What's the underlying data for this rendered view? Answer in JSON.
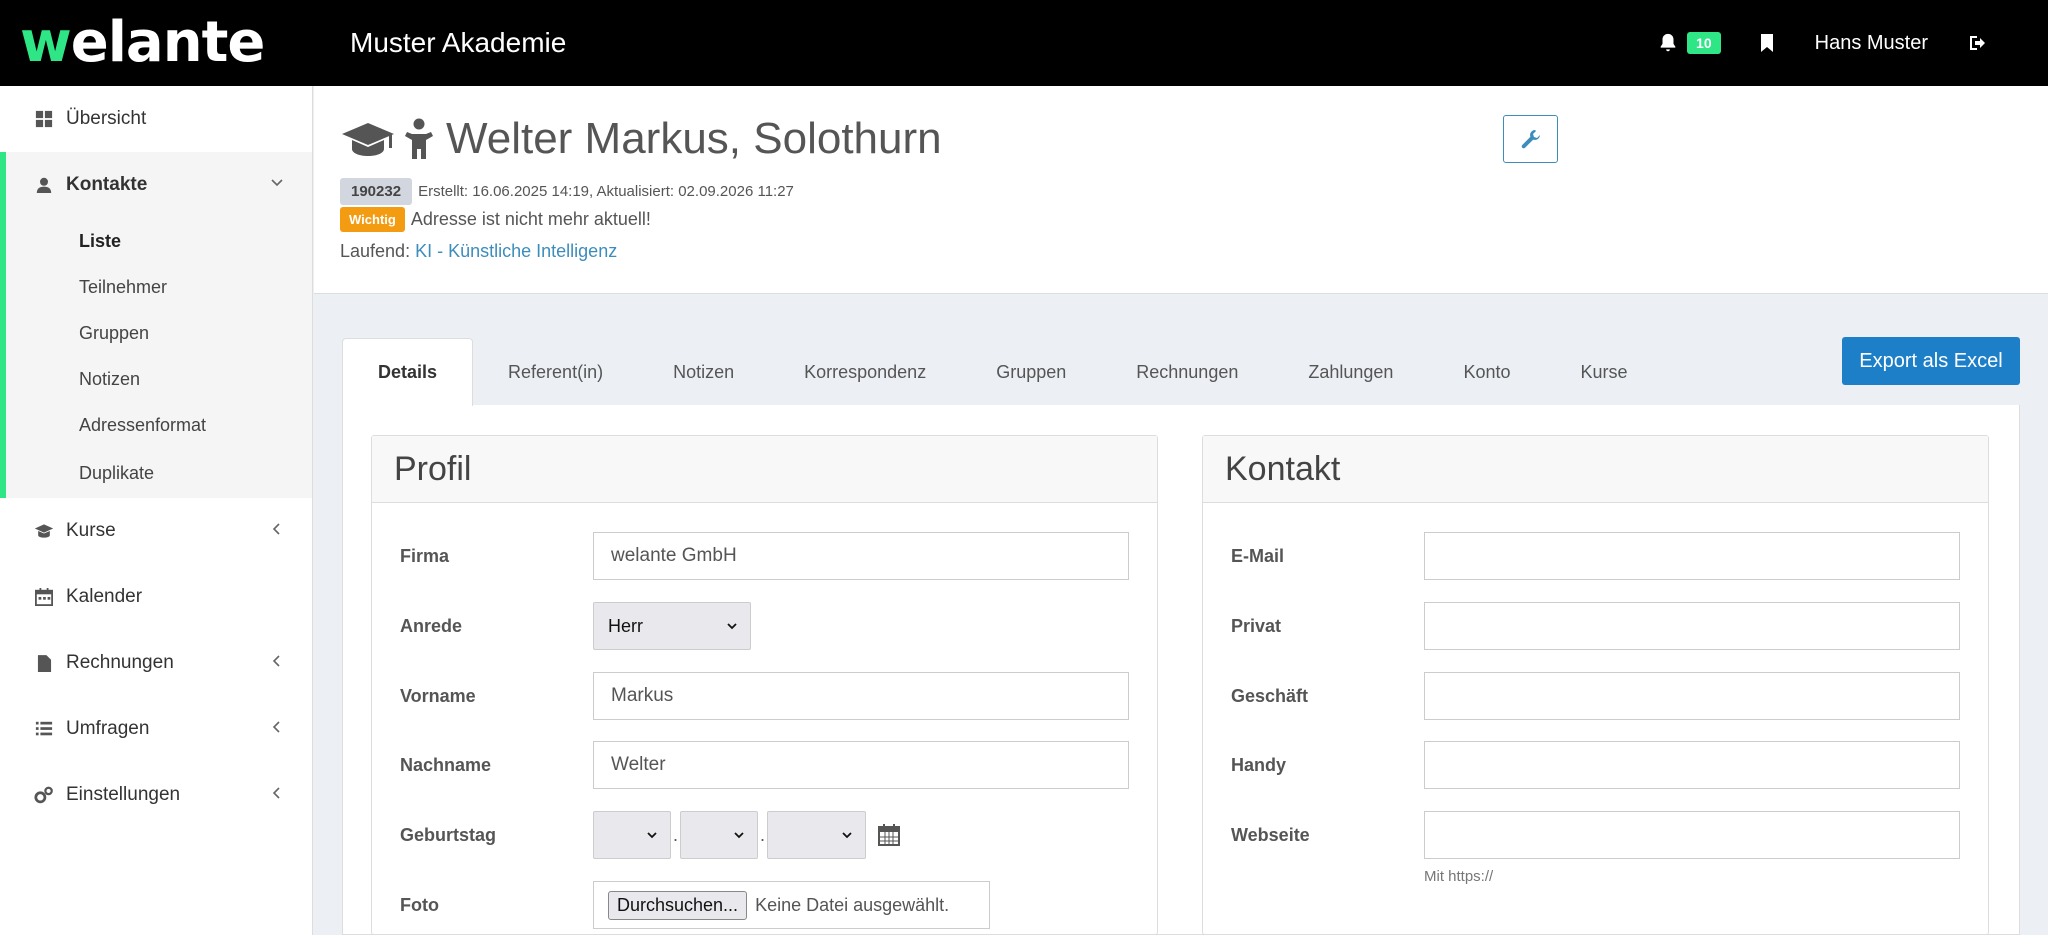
{
  "header": {
    "logo_first": "w",
    "logo_rest": "elante",
    "org_name": "Muster Akademie",
    "notification_count": "10",
    "user_name": "Hans Muster"
  },
  "sidebar": {
    "items": [
      {
        "label": "Übersicht",
        "icon": "dashboard-icon"
      },
      {
        "label": "Kontakte",
        "icon": "user-icon"
      },
      {
        "label": "Kurse",
        "icon": "graduation-cap-icon"
      },
      {
        "label": "Kalender",
        "icon": "calendar-icon"
      },
      {
        "label": "Rechnungen",
        "icon": "file-icon"
      },
      {
        "label": "Umfragen",
        "icon": "list-icon"
      },
      {
        "label": "Einstellungen",
        "icon": "cogs-icon"
      }
    ],
    "kontakte_sub": [
      "Liste",
      "Teilnehmer",
      "Gruppen",
      "Notizen",
      "Adressenformat",
      "Duplikate"
    ]
  },
  "contact": {
    "title": "Welter Markus, Solothurn",
    "id": "190232",
    "meta": "Erstellt: 16.06.2025 14:19, Aktualisiert: 02.09.2026 11:27",
    "warn_badge": "Wichtig",
    "warn_text": "Adresse ist nicht mehr aktuell!",
    "course_label": "Laufend:",
    "course_link": "KI - Künstliche Intelligenz"
  },
  "tabs": [
    "Details",
    "Referent(in)",
    "Notizen",
    "Korrespondenz",
    "Gruppen",
    "Rechnungen",
    "Zahlungen",
    "Konto",
    "Kurse"
  ],
  "export_label": "Export als Excel",
  "profil": {
    "heading": "Profil",
    "firma_label": "Firma",
    "firma_value": "welante GmbH",
    "anrede_label": "Anrede",
    "anrede_value": "Herr",
    "vorname_label": "Vorname",
    "vorname_value": "Markus",
    "nachname_label": "Nachname",
    "nachname_value": "Welter",
    "geburtstag_label": "Geburtstag",
    "foto_label": "Foto",
    "file_button": "Durchsuchen...",
    "file_status": "Keine Datei ausgewählt."
  },
  "kontakt": {
    "heading": "Kontakt",
    "email_label": "E-Mail",
    "privat_label": "Privat",
    "geschaeft_label": "Geschäft",
    "handy_label": "Handy",
    "webseite_label": "Webseite",
    "webseite_hint": "Mit https://"
  },
  "colors": {
    "accent_green": "#2ee685",
    "primary_blue": "#1e7fc9",
    "warning_orange": "#f39c12"
  }
}
